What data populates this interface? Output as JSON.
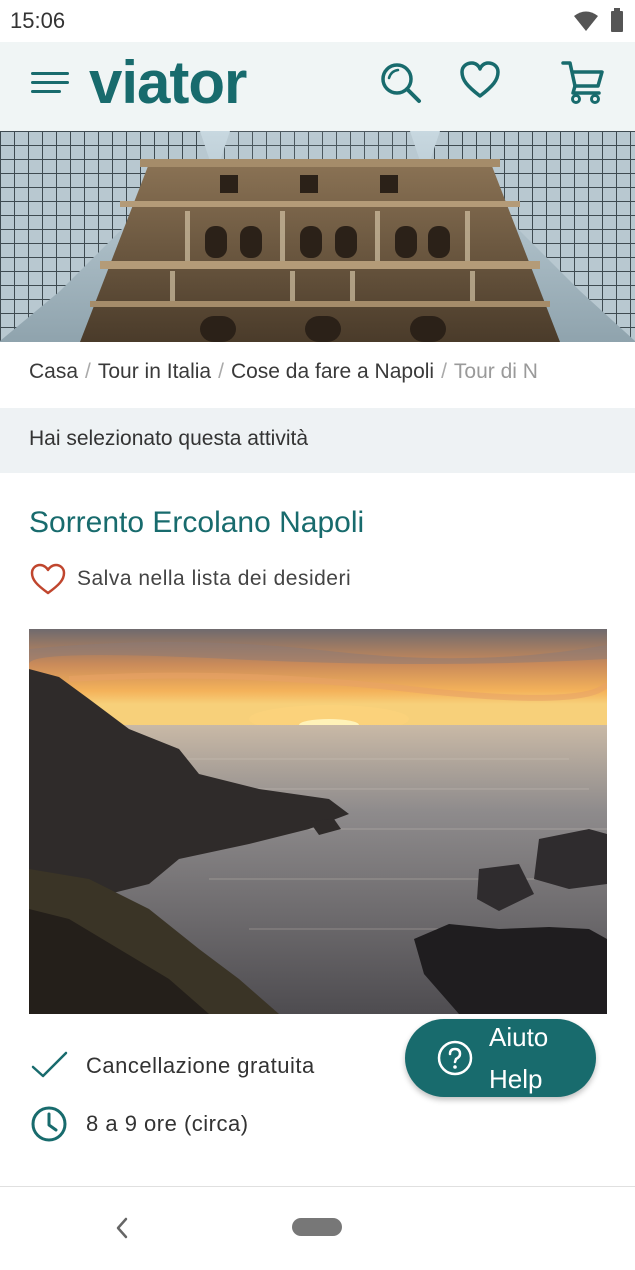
{
  "status_bar": {
    "time": "15:06"
  },
  "header": {
    "brand": "viator"
  },
  "breadcrumb": [
    "Casa",
    "Tour in Italia",
    "Cose da fare a Napoli",
    "Tour di N"
  ],
  "selection_banner": "Hai selezionato questa attività",
  "product": {
    "title": "Sorrento Ercolano Napoli",
    "wishlist_label": "Salva nella lista dei desideri"
  },
  "features": {
    "cancellation": "Cancellazione gratuita",
    "duration": "8 a 9 ore (circa)"
  },
  "help_button": {
    "line1": "Aiuto",
    "line2": "Help"
  },
  "colors": {
    "brand": "#186b6d",
    "wishlist_heart": "#c0462e",
    "header_bg": "#f0f5f5"
  },
  "icons": {
    "menu": "menu-icon",
    "search": "search-icon",
    "wishlist": "heart-icon",
    "cart": "cart-icon",
    "cancellation": "checkmark-icon",
    "duration": "clock-icon",
    "help": "question-icon",
    "nav_back": "back-icon"
  }
}
